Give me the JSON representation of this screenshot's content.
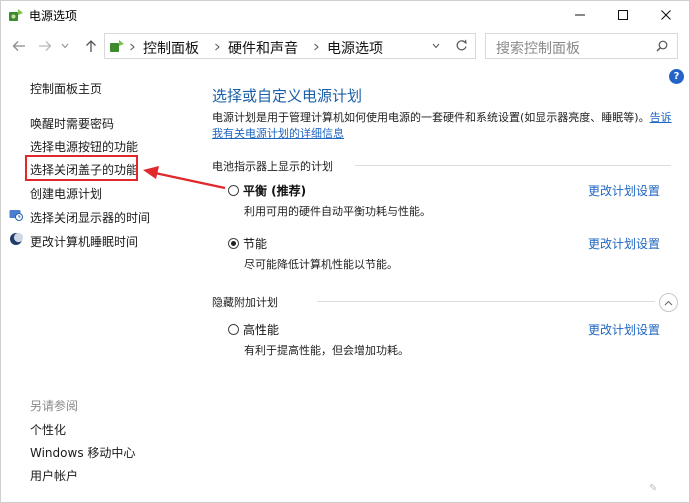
{
  "window": {
    "title": "电源选项"
  },
  "address": {
    "crumbs": [
      "控制面板",
      "硬件和声音",
      "电源选项"
    ],
    "search_placeholder": "搜索控制面板"
  },
  "sidebar": {
    "home": "控制面板主页",
    "links": [
      "唤醒时需要密码",
      "选择电源按钮的功能",
      "选择关闭盖子的功能",
      "创建电源计划",
      "选择关闭显示器的时间",
      "更改计算机睡眠时间"
    ],
    "see_also": {
      "title": "另请参阅",
      "items": [
        "个性化",
        "Windows 移动中心",
        "用户帐户"
      ]
    }
  },
  "main": {
    "heading": "选择或自定义电源计划",
    "description": "电源计划是用于管理计算机如何使用电源的一套硬件和系统设置(如显示器亮度、睡眠等)。",
    "description_link": "告诉我有关电源计划的详细信息",
    "section_battery": "电池指示器上显示的计划",
    "section_hidden": "隐藏附加计划",
    "change_label": "更改计划设置",
    "plans": [
      {
        "name": "平衡 (推荐)",
        "desc": "利用可用的硬件自动平衡功耗与性能。",
        "selected": false
      },
      {
        "name": "节能",
        "desc": "尽可能降低计算机性能以节能。",
        "selected": true
      },
      {
        "name": "高性能",
        "desc": "有利于提高性能，但会增加功耗。",
        "selected": false
      }
    ]
  },
  "colors": {
    "link": "#1f66c1",
    "heading": "#1b5fa8",
    "highlight": "#e0282d"
  }
}
